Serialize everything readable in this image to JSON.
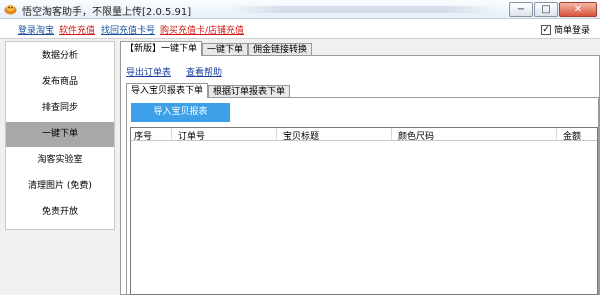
{
  "window": {
    "title": "悟空淘客助手，不限量上传[2.0.5.91]",
    "buttons": {
      "minimize": "−",
      "maximize": "□",
      "close": "✕"
    }
  },
  "linkbar": {
    "links": [
      {
        "label": "登录淘宝",
        "color": "blue"
      },
      {
        "label": "软件充值",
        "color": "red"
      },
      {
        "label": "找回充值卡号",
        "color": "blue"
      },
      {
        "label": "购买充值卡/店铺充值",
        "color": "red"
      }
    ],
    "simple_login": {
      "label": "简单登录",
      "checked": true,
      "mark": "✓"
    }
  },
  "sidebar": {
    "items": [
      {
        "label": "数据分析",
        "active": false
      },
      {
        "label": "发布商品",
        "active": false
      },
      {
        "label": "排查同步",
        "active": false
      },
      {
        "label": "一键下单",
        "active": true
      },
      {
        "label": "淘客实验室",
        "active": false
      },
      {
        "label": "清理图片 (免费)",
        "active": false
      },
      {
        "label": "免责开放",
        "active": false
      }
    ]
  },
  "main": {
    "tabs": [
      {
        "label": "【新版】一键下单",
        "active": true
      },
      {
        "label": "一键下单",
        "active": false
      },
      {
        "label": "佣金链接转换",
        "active": false
      }
    ],
    "links": {
      "export_orders": "导出订单表",
      "view_help": "查看帮助"
    },
    "sub_tabs": [
      {
        "label": "导入宝贝报表下单",
        "active": true
      },
      {
        "label": "根据订单报表下单",
        "active": false
      }
    ],
    "import_button": "导入宝贝报表",
    "table": {
      "columns": [
        "序号",
        "订单号",
        "宝贝标题",
        "颜色尺码",
        "金额"
      ],
      "rows": []
    }
  },
  "colors": {
    "accent_button": "#3ea0e8",
    "link_blue": "#1a4fa0",
    "link_red": "#d01818",
    "sidebar_active": "#a8a8a8"
  }
}
